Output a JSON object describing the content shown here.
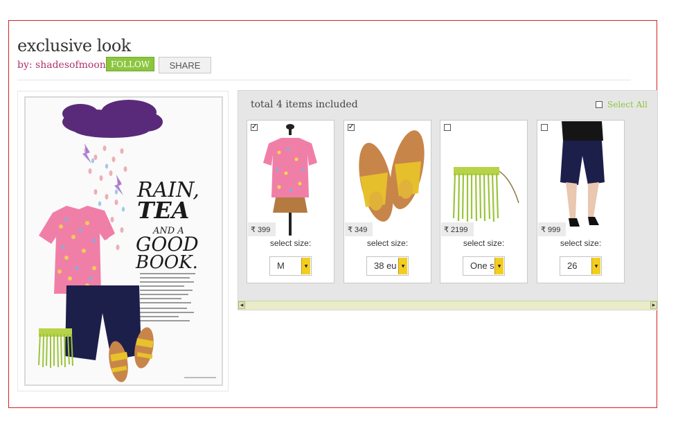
{
  "header": {
    "title": "exclusive look",
    "byline": "by: shadesofmoon",
    "follow_label": "FOLLOW",
    "share_label": "SHARE"
  },
  "collage": {
    "headline_lines": [
      "RAIN,",
      "TEA",
      "AND A",
      "GOOD",
      "BOOK."
    ]
  },
  "items_panel": {
    "summary": "total 4 items included",
    "select_all_label": "Select All",
    "items": [
      {
        "name": "floral top",
        "checked": true,
        "price": "₹ 399",
        "size_label": "select size:",
        "size_value": "M"
      },
      {
        "name": "yellow sandals",
        "checked": true,
        "price": "₹ 349",
        "size_label": "select size:",
        "size_value": "38 eu"
      },
      {
        "name": "green fringe clutch",
        "checked": false,
        "price": "₹ 2199",
        "size_label": "select size:",
        "size_value": "One s"
      },
      {
        "name": "navy shorts",
        "checked": false,
        "price": "₹ 999",
        "size_label": "select size:",
        "size_value": "26"
      }
    ]
  },
  "colors": {
    "frame": "#d62020",
    "follow_button": "#8cc63f",
    "byline": "#b0306b",
    "select_all": "#8cc63f",
    "dropdown_arrow": "#f3ce1f"
  }
}
